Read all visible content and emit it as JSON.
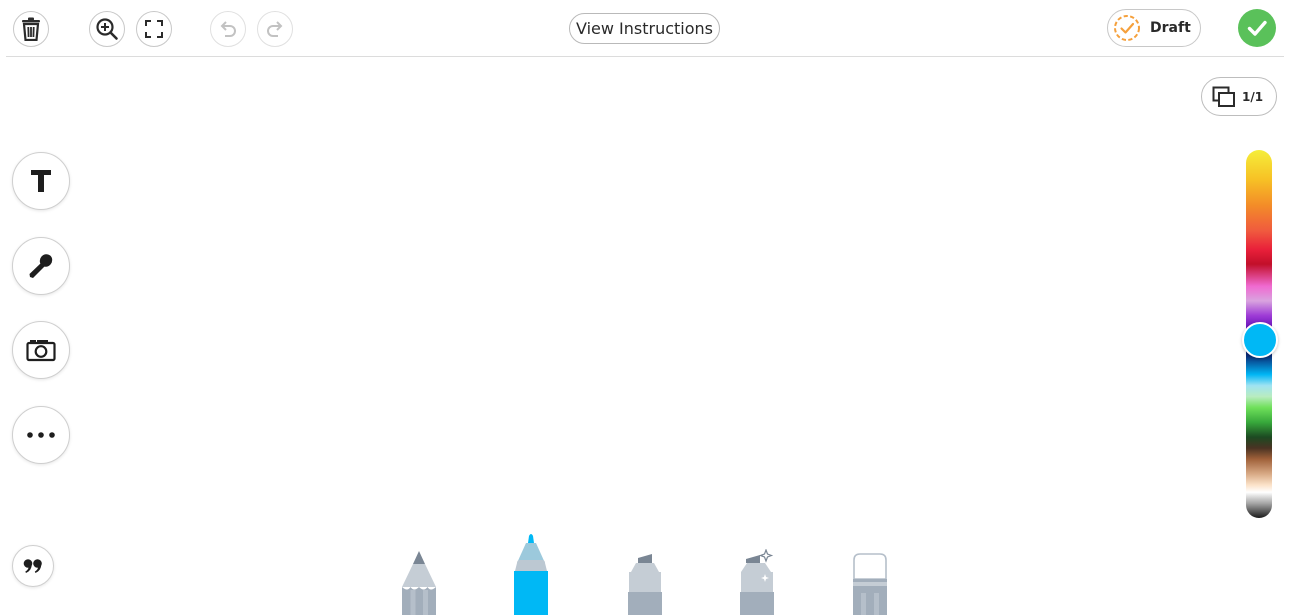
{
  "toolbar": {
    "delete_icon": "trash-icon",
    "zoom_icon": "zoom-in-icon",
    "fullscreen_icon": "fullscreen-icon",
    "undo_icon": "undo-icon",
    "redo_icon": "redo-icon",
    "view_instructions_label": "View Instructions",
    "draft_label": "Draft",
    "done_icon": "checkmark-icon"
  },
  "pages": {
    "indicator": "1/1"
  },
  "side_tools": [
    {
      "name": "text-tool",
      "icon": "text-icon"
    },
    {
      "name": "microphone-tool",
      "icon": "microphone-icon"
    },
    {
      "name": "camera-tool",
      "icon": "camera-icon"
    },
    {
      "name": "more-tool",
      "icon": "more-icon"
    }
  ],
  "quote_tool": {
    "icon": "quote-icon"
  },
  "drawing_tools": [
    {
      "name": "pencil",
      "selected": false
    },
    {
      "name": "marker",
      "selected": true
    },
    {
      "name": "highlighter",
      "selected": false
    },
    {
      "name": "glitter-pen",
      "selected": false
    },
    {
      "name": "eraser",
      "selected": false
    }
  ],
  "colors": {
    "selected": "#00b8f5",
    "accent_green": "#5ac15a",
    "draft_orange": "#f5a03c",
    "tool_gray": "#a2aebb"
  }
}
